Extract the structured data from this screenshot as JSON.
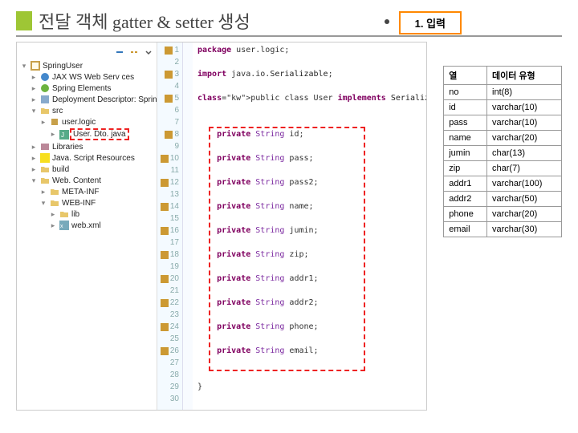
{
  "title": "전달 객체 gatter & setter 생성",
  "badge": "1. 입력",
  "tree": {
    "root": "SpringUser",
    "items": [
      {
        "label": "JAX WS Web Serv ces",
        "icon": "ws"
      },
      {
        "label": "Spring Elements",
        "icon": "spring"
      },
      {
        "label": "Deployment Descriptor: SpringU",
        "icon": "dd"
      },
      {
        "label": "src",
        "icon": "folder",
        "expanded": true
      },
      {
        "label": "user.logic",
        "icon": "package",
        "indent": 2
      },
      {
        "label": "User. Dto. java",
        "icon": "java",
        "indent": 3,
        "highlight": true
      },
      {
        "label": "Libraries",
        "icon": "lib"
      },
      {
        "label": "Java. Script Resources",
        "icon": "js"
      },
      {
        "label": "build",
        "icon": "folder"
      },
      {
        "label": "Web. Content",
        "icon": "folder",
        "expanded": true
      },
      {
        "label": "META-INF",
        "icon": "folder",
        "indent": 2
      },
      {
        "label": "WEB-INF",
        "icon": "folder",
        "indent": 2,
        "expanded": true
      },
      {
        "label": "lib",
        "icon": "folder",
        "indent": 3
      },
      {
        "label": "web.xml",
        "icon": "xml",
        "indent": 3
      }
    ]
  },
  "code": [
    {
      "n": 1,
      "text": "package user.logic;",
      "kw": [
        "package"
      ]
    },
    {
      "n": 2,
      "text": ""
    },
    {
      "n": 3,
      "text": "import java.io.Serializable;",
      "kw": [
        "import"
      ]
    },
    {
      "n": 4,
      "text": ""
    },
    {
      "n": 5,
      "text": "public class User implements Serializable {",
      "kw": [
        "public",
        "class",
        "implements"
      ]
    },
    {
      "n": 6,
      "text": ""
    },
    {
      "n": 7,
      "text": ""
    },
    {
      "n": 8,
      "text": "    private String id;",
      "kw": [
        "private"
      ]
    },
    {
      "n": 9,
      "text": ""
    },
    {
      "n": 10,
      "text": "    private String pass;",
      "kw": [
        "private"
      ]
    },
    {
      "n": 11,
      "text": ""
    },
    {
      "n": 12,
      "text": "    private String pass2;",
      "kw": [
        "private"
      ]
    },
    {
      "n": 13,
      "text": ""
    },
    {
      "n": 14,
      "text": "    private String name;",
      "kw": [
        "private"
      ]
    },
    {
      "n": 15,
      "text": ""
    },
    {
      "n": 16,
      "text": "    private String jumin;",
      "kw": [
        "private"
      ]
    },
    {
      "n": 17,
      "text": ""
    },
    {
      "n": 18,
      "text": "    private String zip;",
      "kw": [
        "private"
      ]
    },
    {
      "n": 19,
      "text": ""
    },
    {
      "n": 20,
      "text": "    private String addr1;",
      "kw": [
        "private"
      ]
    },
    {
      "n": 21,
      "text": ""
    },
    {
      "n": 22,
      "text": "    private String addr2;",
      "kw": [
        "private"
      ]
    },
    {
      "n": 23,
      "text": ""
    },
    {
      "n": 24,
      "text": "    private String phone;",
      "kw": [
        "private"
      ]
    },
    {
      "n": 25,
      "text": ""
    },
    {
      "n": 26,
      "text": "    private String email;",
      "kw": [
        "private"
      ]
    },
    {
      "n": 27,
      "text": ""
    },
    {
      "n": 28,
      "text": ""
    },
    {
      "n": 29,
      "text": "}"
    },
    {
      "n": 30,
      "text": ""
    }
  ],
  "schema": {
    "headers": [
      "열",
      "데이터 유형"
    ],
    "rows": [
      [
        "no",
        "int(8)"
      ],
      [
        "id",
        "varchar(10)"
      ],
      [
        "pass",
        "varchar(10)"
      ],
      [
        "name",
        "varchar(20)"
      ],
      [
        "jumin",
        "char(13)"
      ],
      [
        "zip",
        "char(7)"
      ],
      [
        "addr1",
        "varchar(100)"
      ],
      [
        "addr2",
        "varchar(50)"
      ],
      [
        "phone",
        "varchar(20)"
      ],
      [
        "email",
        "varchar(30)"
      ]
    ]
  }
}
